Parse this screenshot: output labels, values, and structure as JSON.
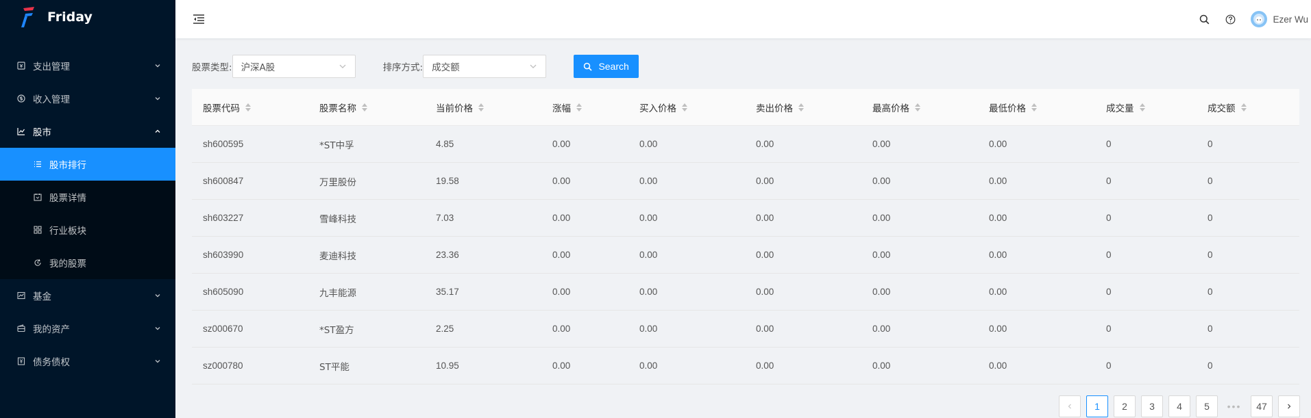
{
  "app": {
    "title": "Friday"
  },
  "colors": {
    "primary": "#1890ff",
    "sidebar_bg": "#001529",
    "submenu_bg": "#000c17"
  },
  "sidebar": {
    "items": [
      {
        "label": "支出管理",
        "icon": "pay-icon"
      },
      {
        "label": "收入管理",
        "icon": "income-icon"
      },
      {
        "label": "股市",
        "icon": "line-chart-icon",
        "open": true
      },
      {
        "label": "基金",
        "icon": "fund-icon"
      },
      {
        "label": "我的资产",
        "icon": "wallet-icon"
      },
      {
        "label": "债务债权",
        "icon": "debt-icon"
      }
    ],
    "stock_submenu": [
      {
        "label": "股市排行",
        "icon": "list-icon",
        "active": true
      },
      {
        "label": "股票详情",
        "icon": "calendar-icon"
      },
      {
        "label": "行业板块",
        "icon": "grid-icon"
      },
      {
        "label": "我的股票",
        "icon": "sync-icon"
      }
    ]
  },
  "header": {
    "user_name": "Ezer Wu",
    "icons": [
      "menu-fold-icon",
      "search-icon",
      "help-icon",
      "avatar"
    ]
  },
  "filters": {
    "stock_type_label": "股票类型:",
    "stock_type_value": "沪深A股",
    "sort_label": "排序方式:",
    "sort_value": "成交额",
    "search_button": "Search"
  },
  "table": {
    "columns": [
      "股票代码",
      "股票名称",
      "当前价格",
      "涨幅",
      "买入价格",
      "卖出价格",
      "最高价格",
      "最低价格",
      "成交量",
      "成交额"
    ],
    "rows": [
      [
        "sh600595",
        "*ST中孚",
        "4.85",
        "0.00",
        "0.00",
        "0.00",
        "0.00",
        "0.00",
        "0",
        "0"
      ],
      [
        "sh600847",
        "万里股份",
        "19.58",
        "0.00",
        "0.00",
        "0.00",
        "0.00",
        "0.00",
        "0",
        "0"
      ],
      [
        "sh603227",
        "雪峰科技",
        "7.03",
        "0.00",
        "0.00",
        "0.00",
        "0.00",
        "0.00",
        "0",
        "0"
      ],
      [
        "sh603990",
        "麦迪科技",
        "23.36",
        "0.00",
        "0.00",
        "0.00",
        "0.00",
        "0.00",
        "0",
        "0"
      ],
      [
        "sh605090",
        "九丰能源",
        "35.17",
        "0.00",
        "0.00",
        "0.00",
        "0.00",
        "0.00",
        "0",
        "0"
      ],
      [
        "sz000670",
        "*ST盈方",
        "2.25",
        "0.00",
        "0.00",
        "0.00",
        "0.00",
        "0.00",
        "0",
        "0"
      ],
      [
        "sz000780",
        "ST平能",
        "10.95",
        "0.00",
        "0.00",
        "0.00",
        "0.00",
        "0.00",
        "0",
        "0"
      ]
    ]
  },
  "pagination": {
    "pages": [
      "1",
      "2",
      "3",
      "4",
      "5"
    ],
    "ellipsis": "•••",
    "last": "47",
    "current": "1"
  }
}
